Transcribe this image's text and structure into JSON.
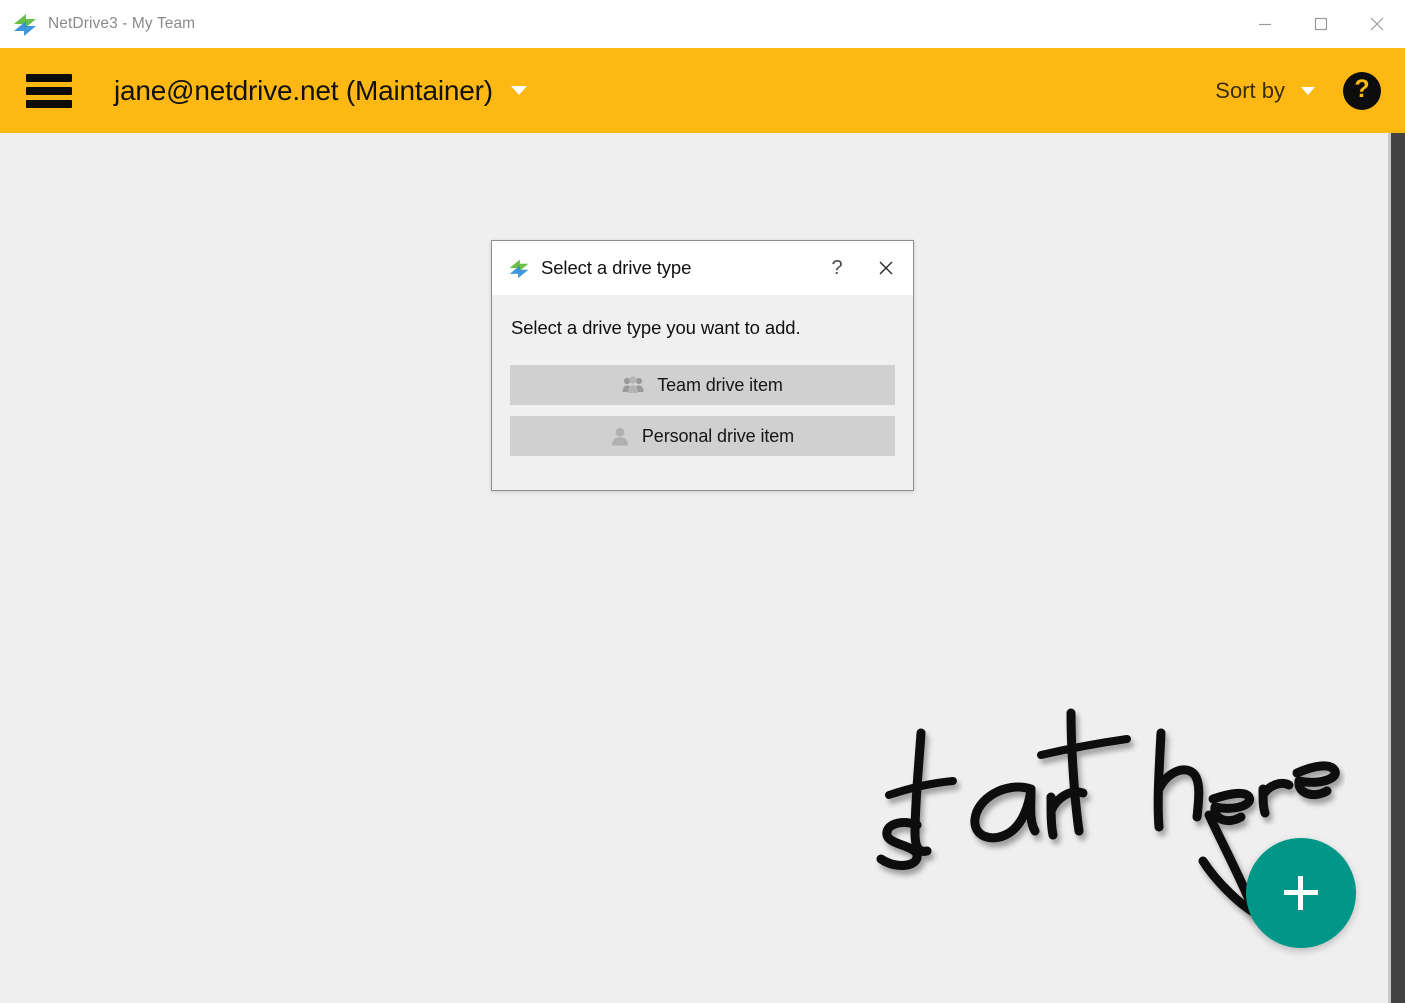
{
  "window": {
    "title": "NetDrive3 - My Team",
    "logo_icon": "netdrive-logo-icon",
    "controls": {
      "minimize": "minimize-icon",
      "maximize": "maximize-icon",
      "close": "close-icon"
    }
  },
  "appbar": {
    "menu_icon": "hamburger-menu-icon",
    "account": "jane@netdrive.net (Maintainer)",
    "account_caret_icon": "chevron-down-icon",
    "sort_by_label": "Sort by",
    "sort_caret_icon": "chevron-down-icon",
    "help_label": "?",
    "help_icon": "help-circle-icon",
    "background_color": "#FDB813"
  },
  "content": {
    "background_color": "#EFEFEF"
  },
  "dialog": {
    "logo_icon": "netdrive-logo-icon",
    "title": "Select a drive type",
    "help_label": "?",
    "close_icon": "close-icon",
    "prompt": "Select a drive type you want to add.",
    "buttons": [
      {
        "label": "Team drive item",
        "icon": "team-people-icon"
      },
      {
        "label": "Personal drive item",
        "icon": "person-icon"
      }
    ]
  },
  "annotation": {
    "text": "start here",
    "arrow_icon": "down-arrow-handdrawn-icon"
  },
  "fab": {
    "label": "+",
    "icon": "plus-icon",
    "color": "#009688"
  }
}
